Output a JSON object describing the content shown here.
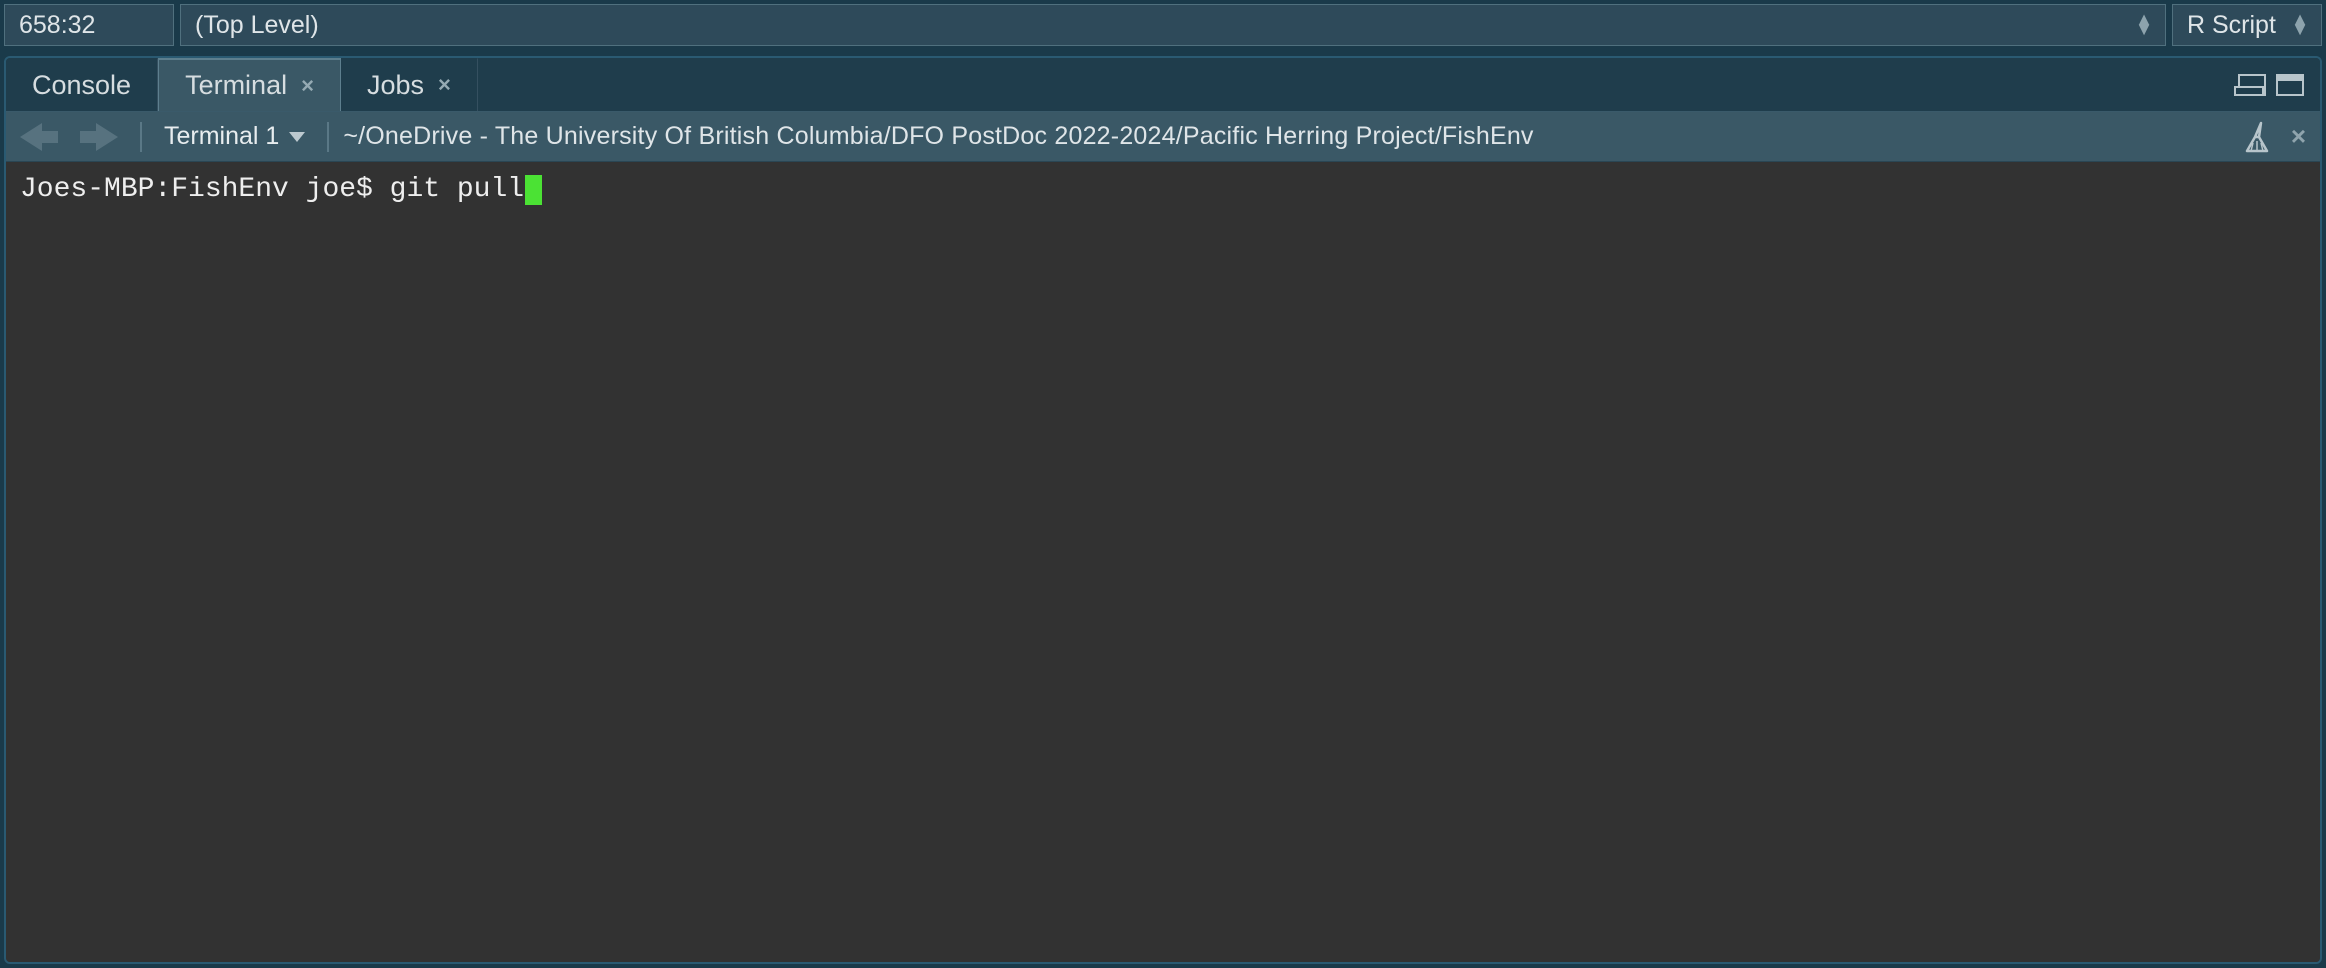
{
  "status_bar": {
    "cursor_position": "658:32",
    "scope_label": "(Top Level)",
    "language_label": "R Script"
  },
  "tabs": {
    "console_label": "Console",
    "terminal_label": "Terminal",
    "jobs_label": "Jobs"
  },
  "toolbar": {
    "terminal_selector_label": "Terminal 1",
    "working_dir": "~/OneDrive - The University Of British Columbia/DFO PostDoc 2022-2024/Pacific Herring Project/FishEnv"
  },
  "terminal": {
    "prompt": "Joes-MBP:FishEnv joe$ ",
    "command": "git pull"
  },
  "icons": {
    "close": "×",
    "clear": "×"
  }
}
